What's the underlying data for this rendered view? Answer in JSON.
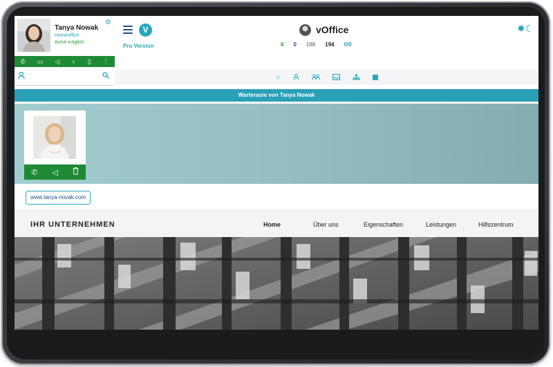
{
  "profile": {
    "name": "Tanya Nowak",
    "status_location": "Homeoffice",
    "status_call": "Anruf möglich"
  },
  "header": {
    "pro_label": "Pro Version",
    "app_title": "vOffice",
    "logo_letter": "V",
    "counts": [
      {
        "value": "6",
        "color": "#2e9a3e"
      },
      {
        "value": "0",
        "color": "#1d4d8a"
      },
      {
        "value": "188",
        "color": "#8a8a8a"
      },
      {
        "value": "194",
        "color": "#222222"
      },
      {
        "value": "0/0",
        "color": "#2aa4b8"
      }
    ]
  },
  "waiting_room": {
    "title": "Warteraum von Tanya Nowak"
  },
  "website": {
    "url": "www.tanya-novak.com",
    "company_name": "IHR UNTERNEHMEN",
    "nav": [
      "Home",
      "Über uns",
      "Eigenschaften",
      "Leistungen",
      "Hilfezentrum"
    ]
  },
  "icons": {
    "action_bar": [
      "phone-icon",
      "chat-icon",
      "megaphone-icon",
      "video-icon",
      "door-icon",
      "more-icon"
    ],
    "nav_icons": [
      "star-icon",
      "user-icon",
      "group-icon",
      "inbox-icon",
      "org-chart-icon",
      "note-icon"
    ],
    "visitor_actions": [
      "phone-icon",
      "megaphone-icon",
      "trash-icon"
    ]
  },
  "colors": {
    "accent": "#2aa0b7",
    "green": "#1f8a35",
    "navy": "#1d4d8a"
  }
}
